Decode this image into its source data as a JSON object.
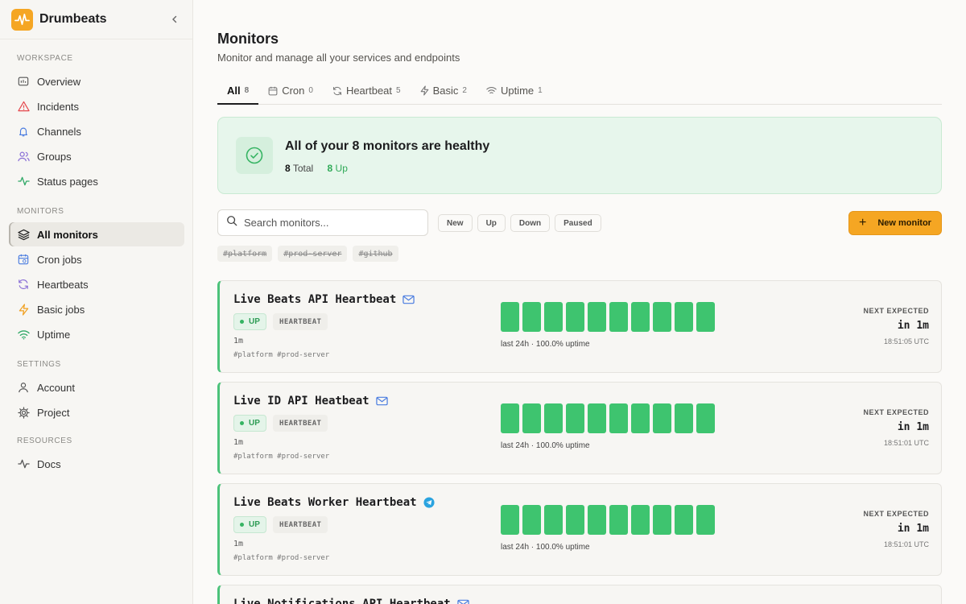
{
  "sidebar": {
    "brand": "Drumbeats",
    "sections": {
      "workspace": "WORKSPACE",
      "monitors": "MONITORS",
      "settings": "SETTINGS",
      "resources": "RESOURCES"
    },
    "items": [
      {
        "label": "Overview",
        "icon": "overview-icon"
      },
      {
        "label": "Incidents",
        "icon": "alert-triangle-icon"
      },
      {
        "label": "Channels",
        "icon": "bell-icon"
      },
      {
        "label": "Groups",
        "icon": "users-icon"
      },
      {
        "label": "Status pages",
        "icon": "activity-icon"
      },
      {
        "label": "All monitors",
        "icon": "layers-icon",
        "active": true
      },
      {
        "label": "Cron jobs",
        "icon": "calendar-icon"
      },
      {
        "label": "Heartbeats",
        "icon": "refresh-icon"
      },
      {
        "label": "Basic jobs",
        "icon": "zap-icon"
      },
      {
        "label": "Uptime",
        "icon": "wifi-icon"
      },
      {
        "label": "Account",
        "icon": "user-icon"
      },
      {
        "label": "Project",
        "icon": "gear-icon"
      },
      {
        "label": "Docs",
        "icon": "pulse-icon"
      }
    ]
  },
  "header": {
    "title": "Monitors",
    "subtitle": "Monitor and manage all your services and endpoints"
  },
  "tabs": [
    {
      "label": "All",
      "count": "8"
    },
    {
      "label": "Cron",
      "count": "0"
    },
    {
      "label": "Heartbeat",
      "count": "5"
    },
    {
      "label": "Basic",
      "count": "2"
    },
    {
      "label": "Uptime",
      "count": "1"
    }
  ],
  "banner": {
    "title": "All of your 8 monitors are healthy",
    "total_value": "8",
    "total_label": "Total",
    "up_value": "8",
    "up_label": "Up"
  },
  "search": {
    "placeholder": "Search monitors..."
  },
  "filters": [
    "New",
    "Up",
    "Down",
    "Paused"
  ],
  "new_monitor_label": "New monitor",
  "tags": [
    "#platform",
    "#prod-server",
    "#github"
  ],
  "colors": {
    "accent": "#f5a623",
    "up": "#3ec46f",
    "healthy_bg": "#e7f6ec"
  },
  "monitors": [
    {
      "name": "Live Beats API Heartbeat",
      "channel_icon": "mail-icon",
      "status": "UP",
      "type": "HEARTBEAT",
      "interval": "1m",
      "tags": "#platform #prod-server",
      "uptime": "last 24h · 100.0% uptime",
      "next_label": "NEXT EXPECTED",
      "next_value": "in 1m",
      "next_time": "18:51:05 UTC",
      "bars": 10
    },
    {
      "name": "Live ID API Heatbeat",
      "channel_icon": "mail-icon",
      "status": "UP",
      "type": "HEARTBEAT",
      "interval": "1m",
      "tags": "#platform #prod-server",
      "uptime": "last 24h · 100.0% uptime",
      "next_label": "NEXT EXPECTED",
      "next_value": "in 1m",
      "next_time": "18:51:01 UTC",
      "bars": 10
    },
    {
      "name": "Live Beats Worker Heartbeat",
      "channel_icon": "telegram-icon",
      "status": "UP",
      "type": "HEARTBEAT",
      "interval": "1m",
      "tags": "#platform #prod-server",
      "uptime": "last 24h · 100.0% uptime",
      "next_label": "NEXT EXPECTED",
      "next_value": "in 1m",
      "next_time": "18:51:01 UTC",
      "bars": 10
    },
    {
      "name": "Live Notifications API Heartbeat",
      "channel_icon": "mail-icon"
    }
  ]
}
